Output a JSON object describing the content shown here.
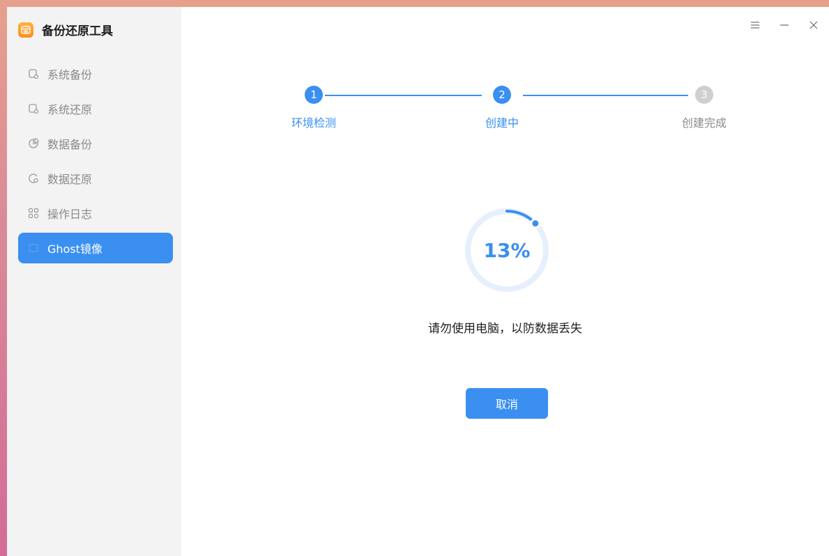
{
  "app": {
    "title": "备份还原工具",
    "logo_icon": "backup-app-icon"
  },
  "sidebar": {
    "items": [
      {
        "label": "系统备份",
        "icon": "system-backup-icon",
        "active": false
      },
      {
        "label": "系统还原",
        "icon": "system-restore-icon",
        "active": false
      },
      {
        "label": "数据备份",
        "icon": "data-backup-icon",
        "active": false
      },
      {
        "label": "数据还原",
        "icon": "data-restore-icon",
        "active": false
      },
      {
        "label": "操作日志",
        "icon": "log-icon",
        "active": false
      },
      {
        "label": "Ghost镜像",
        "icon": "ghost-image-icon",
        "active": true
      }
    ]
  },
  "window_controls": {
    "menu_icon": "menu-icon",
    "minimize_icon": "minimize-icon",
    "close_icon": "close-icon"
  },
  "stepper": {
    "steps": [
      {
        "number": "1",
        "label": "环境检测",
        "state": "done"
      },
      {
        "number": "2",
        "label": "创建中",
        "state": "current"
      },
      {
        "number": "3",
        "label": "创建完成",
        "state": "pending"
      }
    ]
  },
  "progress": {
    "percent": 13,
    "label": "13%"
  },
  "message": "请勿使用电脑，以防数据丢失",
  "cancel_label": "取消",
  "colors": {
    "accent": "#3a8ff0",
    "pending": "#cfcfcf",
    "sidebar_bg": "#f3f3f3"
  }
}
